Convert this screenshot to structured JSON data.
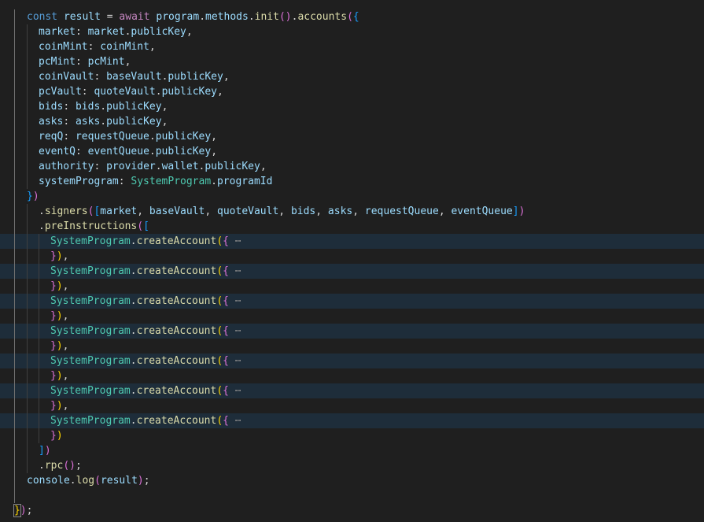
{
  "editor": {
    "theme_background": "#1f1f1f",
    "lines": [
      {
        "fold": false,
        "indent": 2,
        "tokens": [
          [
            "kw",
            "const"
          ],
          [
            "c",
            " "
          ],
          [
            "var",
            "result"
          ],
          [
            "c",
            " = "
          ],
          [
            "kwc",
            "await"
          ],
          [
            "c",
            " "
          ],
          [
            "var",
            "program"
          ],
          [
            "c",
            "."
          ],
          [
            "prp",
            "methods"
          ],
          [
            "c",
            "."
          ],
          [
            "fn",
            "init"
          ],
          [
            "b2",
            "()"
          ],
          [
            "c",
            "."
          ],
          [
            "fn",
            "accounts"
          ],
          [
            "b2",
            "("
          ],
          [
            "b3",
            "{"
          ]
        ]
      },
      {
        "fold": false,
        "indent": 3,
        "tokens": [
          [
            "prp",
            "market"
          ],
          [
            "c",
            ": "
          ],
          [
            "var",
            "market"
          ],
          [
            "c",
            "."
          ],
          [
            "prp",
            "publicKey"
          ],
          [
            "c",
            ","
          ]
        ]
      },
      {
        "fold": false,
        "indent": 3,
        "tokens": [
          [
            "prp",
            "coinMint"
          ],
          [
            "c",
            ": "
          ],
          [
            "var",
            "coinMint"
          ],
          [
            "c",
            ","
          ]
        ]
      },
      {
        "fold": false,
        "indent": 3,
        "tokens": [
          [
            "prp",
            "pcMint"
          ],
          [
            "c",
            ": "
          ],
          [
            "var",
            "pcMint"
          ],
          [
            "c",
            ","
          ]
        ]
      },
      {
        "fold": false,
        "indent": 3,
        "tokens": [
          [
            "prp",
            "coinVault"
          ],
          [
            "c",
            ": "
          ],
          [
            "var",
            "baseVault"
          ],
          [
            "c",
            "."
          ],
          [
            "prp",
            "publicKey"
          ],
          [
            "c",
            ","
          ]
        ]
      },
      {
        "fold": false,
        "indent": 3,
        "tokens": [
          [
            "prp",
            "pcVault"
          ],
          [
            "c",
            ": "
          ],
          [
            "var",
            "quoteVault"
          ],
          [
            "c",
            "."
          ],
          [
            "prp",
            "publicKey"
          ],
          [
            "c",
            ","
          ]
        ]
      },
      {
        "fold": false,
        "indent": 3,
        "tokens": [
          [
            "prp",
            "bids"
          ],
          [
            "c",
            ": "
          ],
          [
            "var",
            "bids"
          ],
          [
            "c",
            "."
          ],
          [
            "prp",
            "publicKey"
          ],
          [
            "c",
            ","
          ]
        ]
      },
      {
        "fold": false,
        "indent": 3,
        "tokens": [
          [
            "prp",
            "asks"
          ],
          [
            "c",
            ": "
          ],
          [
            "var",
            "asks"
          ],
          [
            "c",
            "."
          ],
          [
            "prp",
            "publicKey"
          ],
          [
            "c",
            ","
          ]
        ]
      },
      {
        "fold": false,
        "indent": 3,
        "tokens": [
          [
            "prp",
            "reqQ"
          ],
          [
            "c",
            ": "
          ],
          [
            "var",
            "requestQueue"
          ],
          [
            "c",
            "."
          ],
          [
            "prp",
            "publicKey"
          ],
          [
            "c",
            ","
          ]
        ]
      },
      {
        "fold": false,
        "indent": 3,
        "tokens": [
          [
            "prp",
            "eventQ"
          ],
          [
            "c",
            ": "
          ],
          [
            "var",
            "eventQueue"
          ],
          [
            "c",
            "."
          ],
          [
            "prp",
            "publicKey"
          ],
          [
            "c",
            ","
          ]
        ]
      },
      {
        "fold": false,
        "indent": 3,
        "tokens": [
          [
            "prp",
            "authority"
          ],
          [
            "c",
            ": "
          ],
          [
            "var",
            "provider"
          ],
          [
            "c",
            "."
          ],
          [
            "prp",
            "wallet"
          ],
          [
            "c",
            "."
          ],
          [
            "prp",
            "publicKey"
          ],
          [
            "c",
            ","
          ]
        ]
      },
      {
        "fold": false,
        "indent": 3,
        "tokens": [
          [
            "prp",
            "systemProgram"
          ],
          [
            "c",
            ": "
          ],
          [
            "cls",
            "SystemProgram"
          ],
          [
            "c",
            "."
          ],
          [
            "prp",
            "programId"
          ]
        ]
      },
      {
        "fold": false,
        "indent": 2,
        "tokens": [
          [
            "b3",
            "}"
          ],
          [
            "b2",
            ")"
          ]
        ]
      },
      {
        "fold": false,
        "indent": 3,
        "tokens": [
          [
            "c",
            "."
          ],
          [
            "fn",
            "signers"
          ],
          [
            "b2",
            "("
          ],
          [
            "b3",
            "["
          ],
          [
            "var",
            "market"
          ],
          [
            "c",
            ", "
          ],
          [
            "var",
            "baseVault"
          ],
          [
            "c",
            ", "
          ],
          [
            "var",
            "quoteVault"
          ],
          [
            "c",
            ", "
          ],
          [
            "var",
            "bids"
          ],
          [
            "c",
            ", "
          ],
          [
            "var",
            "asks"
          ],
          [
            "c",
            ", "
          ],
          [
            "var",
            "requestQueue"
          ],
          [
            "c",
            ", "
          ],
          [
            "var",
            "eventQueue"
          ],
          [
            "b3",
            "]"
          ],
          [
            "b2",
            ")"
          ]
        ]
      },
      {
        "fold": false,
        "indent": 3,
        "tokens": [
          [
            "c",
            "."
          ],
          [
            "fn",
            "preInstructions"
          ],
          [
            "b2",
            "("
          ],
          [
            "b3",
            "["
          ]
        ]
      },
      {
        "fold": true,
        "indent": 4,
        "tokens": [
          [
            "cls",
            "SystemProgram"
          ],
          [
            "c",
            "."
          ],
          [
            "fn",
            "createAccount"
          ],
          [
            "b1",
            "("
          ],
          [
            "b2",
            "{"
          ],
          [
            "ell",
            " ⋯"
          ]
        ]
      },
      {
        "fold": false,
        "indent": 4,
        "tokens": [
          [
            "b2",
            "}"
          ],
          [
            "b1",
            ")"
          ],
          [
            "c",
            ","
          ]
        ]
      },
      {
        "fold": true,
        "indent": 4,
        "tokens": [
          [
            "cls",
            "SystemProgram"
          ],
          [
            "c",
            "."
          ],
          [
            "fn",
            "createAccount"
          ],
          [
            "b1",
            "("
          ],
          [
            "b2",
            "{"
          ],
          [
            "ell",
            " ⋯"
          ]
        ]
      },
      {
        "fold": false,
        "indent": 4,
        "tokens": [
          [
            "b2",
            "}"
          ],
          [
            "b1",
            ")"
          ],
          [
            "c",
            ","
          ]
        ]
      },
      {
        "fold": true,
        "indent": 4,
        "tokens": [
          [
            "cls",
            "SystemProgram"
          ],
          [
            "c",
            "."
          ],
          [
            "fn",
            "createAccount"
          ],
          [
            "b1",
            "("
          ],
          [
            "b2",
            "{"
          ],
          [
            "ell",
            " ⋯"
          ]
        ]
      },
      {
        "fold": false,
        "indent": 4,
        "tokens": [
          [
            "b2",
            "}"
          ],
          [
            "b1",
            ")"
          ],
          [
            "c",
            ","
          ]
        ]
      },
      {
        "fold": true,
        "indent": 4,
        "tokens": [
          [
            "cls",
            "SystemProgram"
          ],
          [
            "c",
            "."
          ],
          [
            "fn",
            "createAccount"
          ],
          [
            "b1",
            "("
          ],
          [
            "b2",
            "{"
          ],
          [
            "ell",
            " ⋯"
          ]
        ]
      },
      {
        "fold": false,
        "indent": 4,
        "tokens": [
          [
            "b2",
            "}"
          ],
          [
            "b1",
            ")"
          ],
          [
            "c",
            ","
          ]
        ]
      },
      {
        "fold": true,
        "indent": 4,
        "tokens": [
          [
            "cls",
            "SystemProgram"
          ],
          [
            "c",
            "."
          ],
          [
            "fn",
            "createAccount"
          ],
          [
            "b1",
            "("
          ],
          [
            "b2",
            "{"
          ],
          [
            "ell",
            " ⋯"
          ]
        ]
      },
      {
        "fold": false,
        "indent": 4,
        "tokens": [
          [
            "b2",
            "}"
          ],
          [
            "b1",
            ")"
          ],
          [
            "c",
            ","
          ]
        ]
      },
      {
        "fold": true,
        "indent": 4,
        "tokens": [
          [
            "cls",
            "SystemProgram"
          ],
          [
            "c",
            "."
          ],
          [
            "fn",
            "createAccount"
          ],
          [
            "b1",
            "("
          ],
          [
            "b2",
            "{"
          ],
          [
            "ell",
            " ⋯"
          ]
        ]
      },
      {
        "fold": false,
        "indent": 4,
        "tokens": [
          [
            "b2",
            "}"
          ],
          [
            "b1",
            ")"
          ],
          [
            "c",
            ","
          ]
        ]
      },
      {
        "fold": true,
        "indent": 4,
        "tokens": [
          [
            "cls",
            "SystemProgram"
          ],
          [
            "c",
            "."
          ],
          [
            "fn",
            "createAccount"
          ],
          [
            "b1",
            "("
          ],
          [
            "b2",
            "{"
          ],
          [
            "ell",
            " ⋯"
          ]
        ]
      },
      {
        "fold": false,
        "indent": 4,
        "tokens": [
          [
            "b2",
            "}"
          ],
          [
            "b1",
            ")"
          ]
        ]
      },
      {
        "fold": false,
        "indent": 3,
        "tokens": [
          [
            "b3",
            "]"
          ],
          [
            "b2",
            ")"
          ]
        ]
      },
      {
        "fold": false,
        "indent": 3,
        "tokens": [
          [
            "c",
            "."
          ],
          [
            "fn",
            "rpc"
          ],
          [
            "b2",
            "()"
          ],
          [
            "c",
            ";"
          ]
        ]
      },
      {
        "fold": false,
        "indent": 2,
        "tokens": [
          [
            "var",
            "console"
          ],
          [
            "c",
            "."
          ],
          [
            "fn",
            "log"
          ],
          [
            "b2",
            "("
          ],
          [
            "var",
            "result"
          ],
          [
            "b2",
            ")"
          ],
          [
            "c",
            ";"
          ]
        ]
      },
      {
        "fold": false,
        "indent": 2,
        "tokens": []
      },
      {
        "fold": false,
        "indent": 1,
        "tokens": [
          [
            "b1box",
            "}"
          ],
          [
            "b2",
            ")"
          ],
          [
            "c",
            ";"
          ]
        ]
      }
    ]
  }
}
